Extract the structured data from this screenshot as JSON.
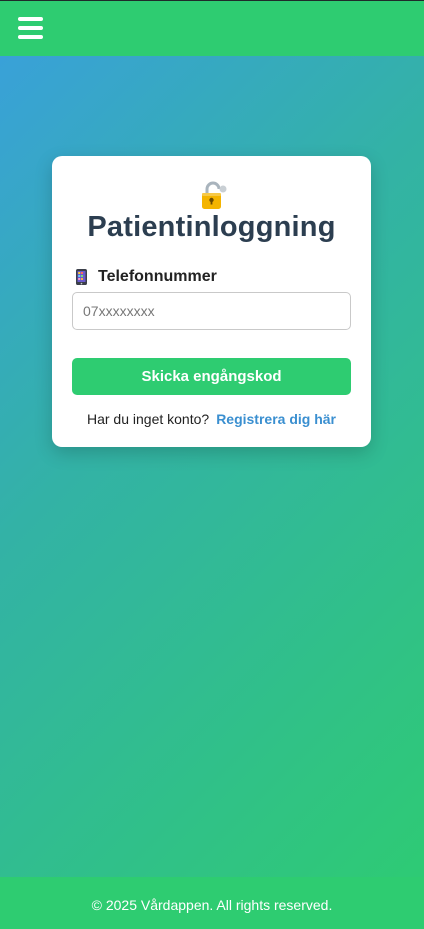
{
  "header": {
    "menu_icon": "hamburger-menu-icon"
  },
  "login_card": {
    "icon": "lock-icon",
    "title": "Patientinloggning",
    "phone_label": "Telefonnummer",
    "phone_icon": "mobile-phone-icon",
    "phone_input": {
      "value": "",
      "placeholder": "07xxxxxxxx"
    },
    "send_button_label": "Skicka engångskod",
    "register_prompt": "Har du inget konto?",
    "register_link": "Registrera dig här"
  },
  "footer": {
    "text": "© 2025 Vårdappen. All rights reserved."
  },
  "colors": {
    "brand_green": "#2ecc71",
    "title_text": "#2c3e50",
    "link_blue": "#3a8fd0",
    "gradient_start": "#3a9fde",
    "gradient_end": "#2ecc71"
  }
}
